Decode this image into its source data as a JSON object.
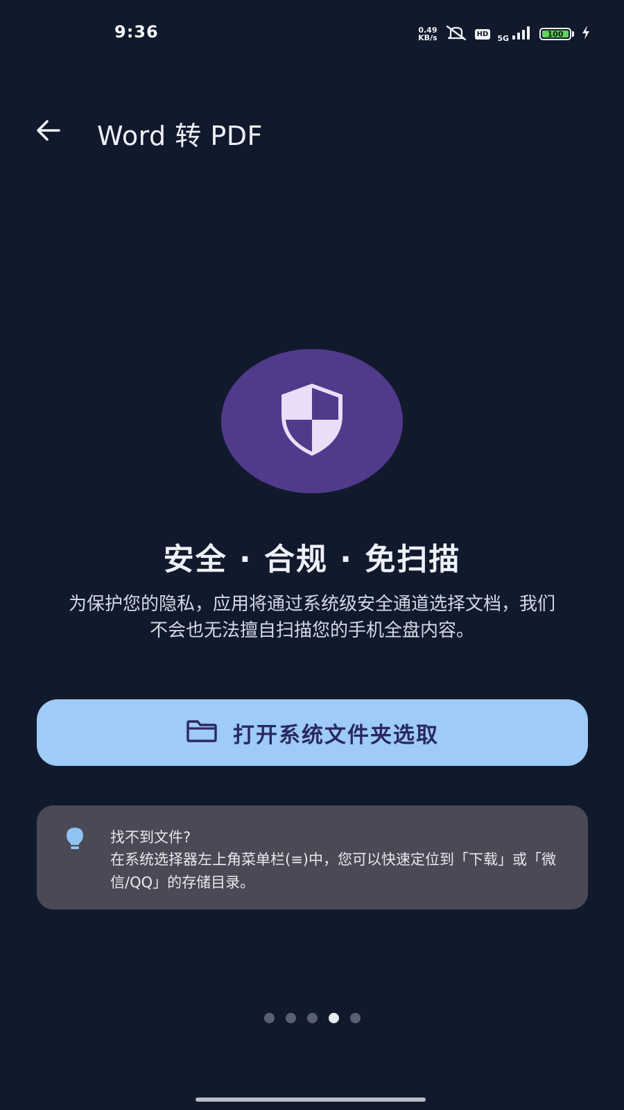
{
  "status_bar": {
    "time": "9:36",
    "net_speed_value": "0.49",
    "net_speed_unit": "KB/s",
    "hd_badge": "HD",
    "network_type": "5G",
    "battery_level": "100",
    "icons": [
      "mute-icon",
      "signal-icon",
      "battery-icon",
      "charging-icon"
    ]
  },
  "header": {
    "back_icon": "arrow-left-icon",
    "title": "Word 转 PDF"
  },
  "hero": {
    "icon": "shield-icon",
    "headline": "安全 · 合规 · 免扫描",
    "description": "为保护您的隐私，应用将通过系统级安全通道选择文档，我们不会也无法擅自扫描您的手机全盘内容。"
  },
  "primary_action": {
    "icon": "folder-icon",
    "label": "打开系统文件夹选取"
  },
  "tip": {
    "icon": "lightbulb-icon",
    "title": "找不到文件?",
    "body": "在系统选择器左上角菜单栏(≡)中，您可以快速定位到「下载」或「微信/QQ」的存储目录。"
  },
  "pager": {
    "total": 5,
    "active_index": 3
  },
  "colors": {
    "background": "#111a2c",
    "shield_circle": "#51398c",
    "primary_button": "#9ecbf7",
    "primary_button_text": "#2a2960",
    "tip_card": "#4a4955",
    "tip_icon": "#8fc3f2"
  }
}
